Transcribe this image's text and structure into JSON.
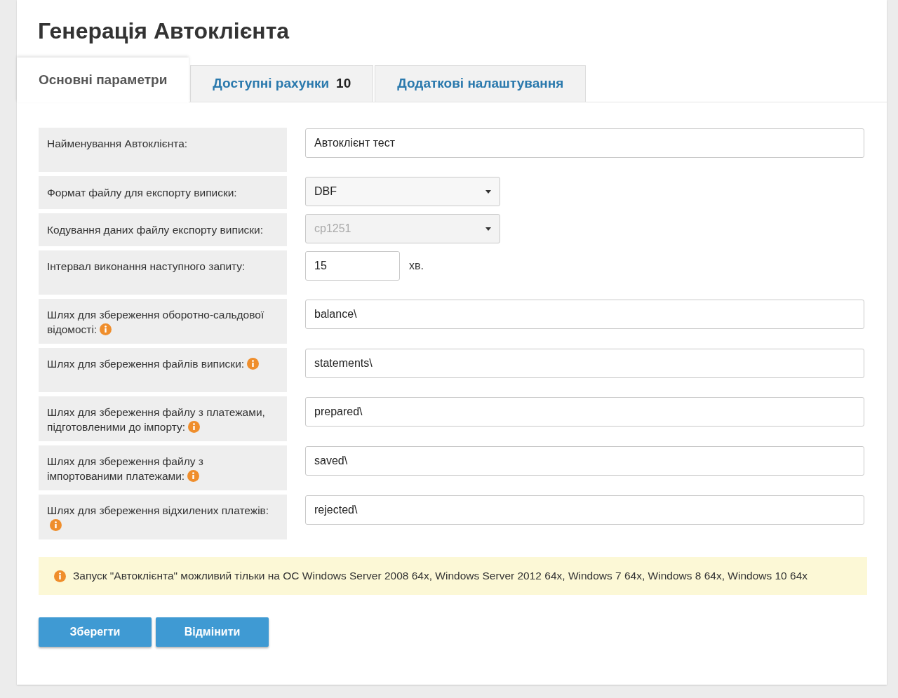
{
  "title": "Генерація Автоклієнта",
  "tabs": [
    {
      "label": "Основні параметри",
      "selected": true
    },
    {
      "label": "Доступні рахунки",
      "count": "10",
      "selected": false
    },
    {
      "label": "Додаткові налаштування",
      "selected": false
    }
  ],
  "fields": [
    {
      "kind": "text",
      "label": "Найменування Автоклієнта:",
      "value": "Автоклієнт тест",
      "info": false
    },
    {
      "kind": "select",
      "label": "Формат файлу для експорту виписки:",
      "value": "DBF",
      "disabled": false,
      "info": false
    },
    {
      "kind": "select",
      "label": "Кодування даних файлу експорту виписки:",
      "value": "cp1251",
      "disabled": true,
      "info": false
    },
    {
      "kind": "number",
      "label": "Інтервал виконання наступного запиту:",
      "value": "15",
      "unit": "хв.",
      "info": false
    },
    {
      "kind": "text",
      "label": "Шлях для збереження оборотно-сальдової відомості:",
      "value": "balance\\",
      "info": true
    },
    {
      "kind": "text",
      "label": "Шлях для збереження файлів виписки:",
      "value": "statements\\",
      "info": true
    },
    {
      "kind": "text",
      "label": "Шлях для збереження файлу з платежами, підготовленими до імпорту:",
      "value": "prepared\\",
      "info": true
    },
    {
      "kind": "text",
      "label": "Шлях для збереження файлу з імпортованими платежами:",
      "value": "saved\\",
      "info": true
    },
    {
      "kind": "text",
      "label": "Шлях для збереження відхилених платежів:",
      "value": "rejected\\",
      "info": true
    }
  ],
  "notice": "Запуск \"Автоклієнта\" можливий тільки на ОС Windows Server 2008 64x, Windows Server 2012 64x, Windows 7 64x, Windows 8 64x, Windows 10 64x",
  "buttons": [
    "Зберегти",
    "Відмінити"
  ]
}
